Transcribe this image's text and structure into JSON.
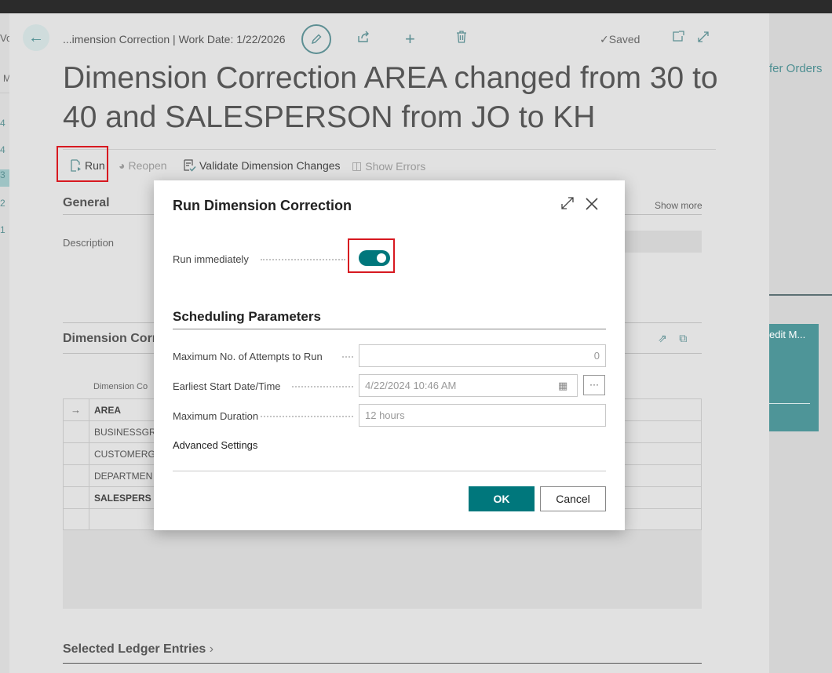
{
  "window": {
    "breadcrumb": "...imension Correction | Work Date: 1/22/2026",
    "saved_label": "Saved",
    "page_title": "Dimension Correction AREA changed from 30 to 40 and SALESPERSON from JO to KH"
  },
  "background_left": {
    "prefix": "Vo",
    "m_letter": "M",
    "numbers": [
      "4",
      "4",
      "3",
      "2",
      "1"
    ]
  },
  "background_right": {
    "link": "fer Orders",
    "tile_text": "edit M..."
  },
  "actions": {
    "run": "Run",
    "reopen": "Reopen",
    "validate": "Validate Dimension Changes",
    "show_errors": "Show Errors"
  },
  "general": {
    "title": "General",
    "show_more": "Show more",
    "description_label": "Description"
  },
  "dimension_section": {
    "title": "Dimension Corre",
    "column_header": "Dimension Co",
    "rows": [
      "AREA",
      "BUSINESSGR",
      "CUSTOMERG",
      "DEPARTMEN",
      "SALESPERS",
      ""
    ]
  },
  "ledger": {
    "title": "Selected Ledger Entries"
  },
  "modal": {
    "title": "Run Dimension Correction",
    "run_immediately_label": "Run immediately",
    "run_immediately_value": true,
    "scheduling_title": "Scheduling Parameters",
    "max_attempts_label": "Maximum No. of Attempts to Run",
    "max_attempts_value": "0",
    "earliest_start_label": "Earliest Start Date/Time",
    "earliest_start_value": "4/22/2024 10:46 AM",
    "ellipsis": "···",
    "max_duration_label": "Maximum Duration",
    "max_duration_value": "12 hours",
    "advanced_settings": "Advanced Settings",
    "ok": "OK",
    "cancel": "Cancel"
  },
  "colors": {
    "accent": "#00777c",
    "highlight": "#d71920"
  }
}
